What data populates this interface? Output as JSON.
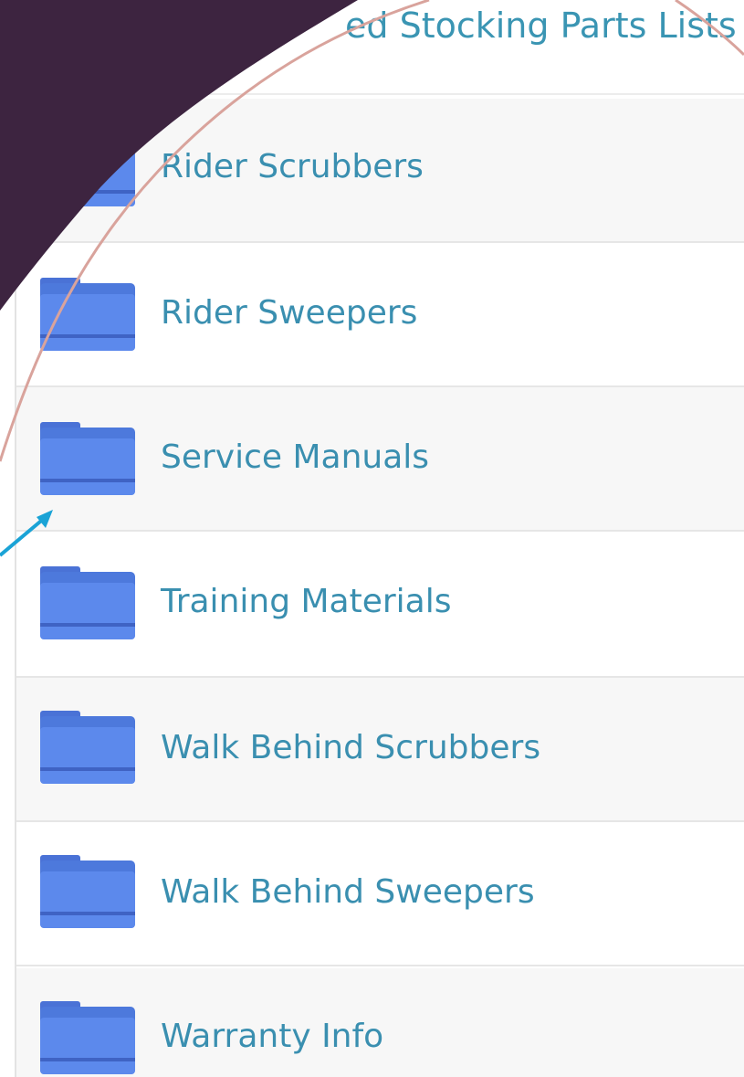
{
  "header": {
    "label": "ed Stocking Parts Lists"
  },
  "folders": [
    {
      "label": "Rider Scrubbers",
      "icon": "folder-icon"
    },
    {
      "label": "Rider Sweepers",
      "icon": "folder-icon"
    },
    {
      "label": "Service Manuals",
      "icon": "folder-icon"
    },
    {
      "label": "Training Materials",
      "icon": "folder-icon"
    },
    {
      "label": "Walk Behind Scrubbers",
      "icon": "folder-icon"
    },
    {
      "label": "Walk Behind Sweepers",
      "icon": "folder-icon"
    },
    {
      "label": "Warranty Info",
      "icon": "folder-icon"
    }
  ],
  "colors": {
    "link": "#3a8fb0",
    "folder": "#4f7fe0",
    "overlay": "#3d2440",
    "arc": "#d9a39c",
    "arrow": "#1aa3d6"
  }
}
